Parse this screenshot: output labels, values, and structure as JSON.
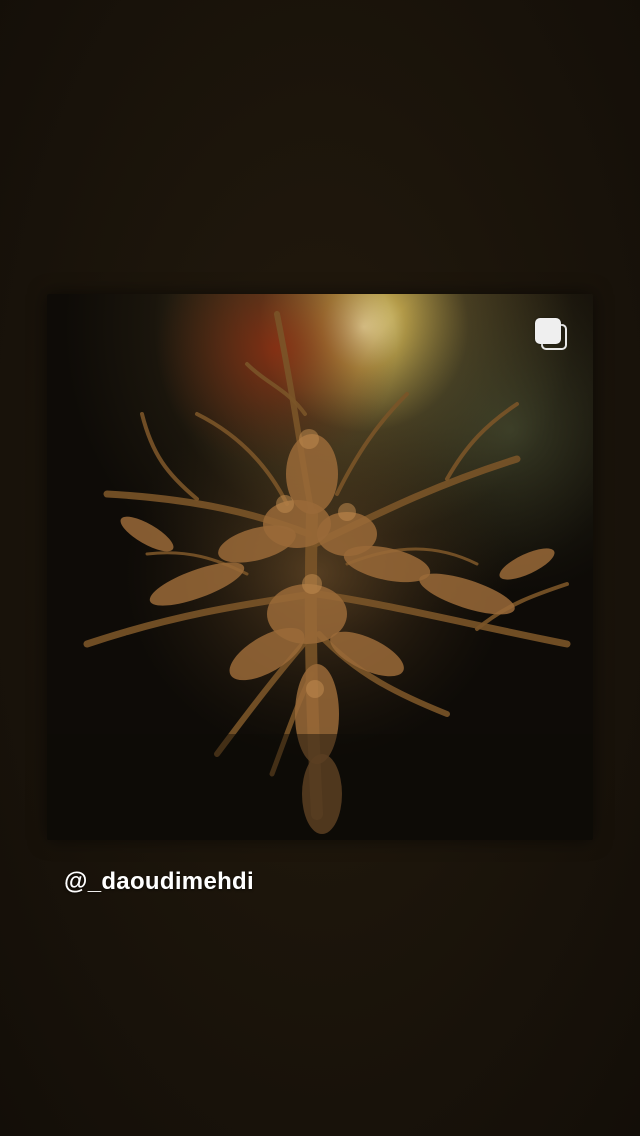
{
  "story": {
    "mention_sticker": {
      "text": "@_daoudimehdi"
    },
    "shared_post": {
      "multi_photo_icon": "carousel-stack-icon",
      "image_subject": "artwork-figures-entwined-in-antler-branches"
    }
  },
  "colors": {
    "background": "#1c150b",
    "mention_text": "#ffffff",
    "icon": "#efefef"
  }
}
